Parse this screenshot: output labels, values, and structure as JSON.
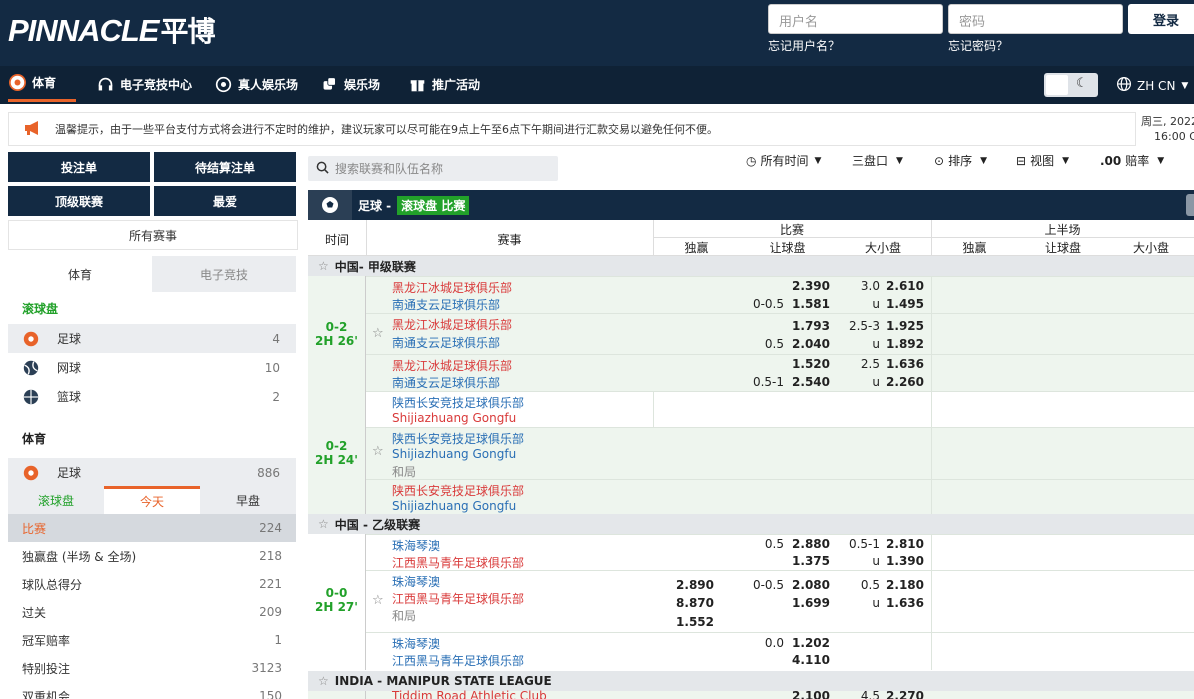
{
  "header": {
    "logo": "PINNACLE",
    "logo_cn": "平博",
    "username_placeholder": "用户名",
    "password_placeholder": "密码",
    "forgot_username": "忘记用户名？",
    "forgot_password": "忘记密码？",
    "login": "登录"
  },
  "nav": {
    "items": [
      "体育",
      "电子竞技中心",
      "真人娱乐场",
      "娱乐场",
      "推广活动"
    ],
    "lang": "ZH CN"
  },
  "notice": {
    "text": "温馨提示，由于一些平台支付方式将会进行不定时的维护，建议玩家可以尽可能在9点上午至6点下午期间进行汇款交易以避免任何不便。",
    "date_line1": "周三, 2022",
    "date_line2": "16:00 G"
  },
  "leftbtns": [
    "投注单",
    "待结算注单",
    "顶级联赛",
    "最爱"
  ],
  "all_events": "所有赛事",
  "sidebar": {
    "tab_sports": "体育",
    "tab_esports": "电子竞技",
    "live_label": "滚球盘",
    "live_sports": [
      {
        "name": "足球",
        "count": "4"
      },
      {
        "name": "网球",
        "count": "10"
      },
      {
        "name": "篮球",
        "count": "2"
      }
    ],
    "sports_label": "体育",
    "soccer": {
      "name": "足球",
      "count": "886"
    },
    "subtabs": [
      "滚球盘",
      "今天",
      "早盘"
    ],
    "markets": [
      {
        "name": "比赛",
        "count": "224"
      },
      {
        "name": "独赢盘 (半场 & 全场)",
        "count": "218"
      },
      {
        "name": "球队总得分",
        "count": "221"
      },
      {
        "name": "过关",
        "count": "209"
      },
      {
        "name": "冠军赔率",
        "count": "1"
      },
      {
        "name": "特别投注",
        "count": "3123"
      },
      {
        "name": "双重机会",
        "count": "150"
      }
    ]
  },
  "toolbar": {
    "search_placeholder": "搜索联赛和队伍名称",
    "all_time": "所有时间",
    "three_lines": "三盘口",
    "sort": "排序",
    "view": "视图",
    "odds_prefix": ".00",
    "odds": "赔率"
  },
  "grid": {
    "title": "足球 -",
    "badge": "滚球盘 比赛",
    "col_time": "时间",
    "col_event": "赛事",
    "group_match": "比赛",
    "group_half": "上半场",
    "sub_cols": [
      "独赢",
      "让球盘",
      "大小盘",
      "独赢",
      "让球盘",
      "大小盘"
    ],
    "leagues": [
      {
        "name": "中国- 甲级联赛",
        "events": [
          {
            "score": "0-2",
            "time": "2H 26'",
            "lines": [
              {
                "home": "黑龙江冰城足球俱乐部",
                "away": "南通支云足球俱乐部",
                "hcp_line": "0-0.5",
                "hcp_home": "2.390",
                "hcp_away": "1.581",
                "ou_line": "3.0",
                "ou_u": "u",
                "ou_over": "2.610",
                "ou_under": "1.495"
              },
              {
                "home": "黑龙江冰城足球俱乐部",
                "away": "南通支云足球俱乐部",
                "hcp_line": "0.5",
                "hcp_home": "1.793",
                "hcp_away": "2.040",
                "ou_line": "2.5-3",
                "ou_u": "u",
                "ou_over": "1.925",
                "ou_under": "1.892"
              },
              {
                "home": "黑龙江冰城足球俱乐部",
                "away": "南通支云足球俱乐部",
                "hcp_line": "0.5-1",
                "hcp_home": "1.520",
                "hcp_away": "2.540",
                "ou_line": "2.5",
                "ou_u": "u",
                "ou_over": "1.636",
                "ou_under": "2.260"
              }
            ]
          },
          {
            "score": "0-2",
            "time": "2H 24'",
            "lines": [
              {
                "home": "陕西长安竞技足球俱乐部",
                "away": "Shijiazhuang Gongfu"
              },
              {
                "home": "陕西长安竞技足球俱乐部",
                "away": "Shijiazhuang Gongfu",
                "draw": "和局"
              },
              {
                "home": "陕西长安竞技足球俱乐部",
                "away": "Shijiazhuang Gongfu"
              }
            ]
          }
        ]
      },
      {
        "name": "中国 - 乙级联赛",
        "events": [
          {
            "score": "0-0",
            "time": "2H 27'",
            "lines": [
              {
                "home": "珠海琴澳",
                "away": "江西黑马青年足球俱乐部",
                "hcp_line": "0.5",
                "hcp_home": "2.880",
                "hcp_away": "1.375",
                "ou_line": "0.5-1",
                "ou_u": "u",
                "ou_over": "2.810",
                "ou_under": "1.390"
              },
              {
                "home": "珠海琴澳",
                "away": "江西黑马青年足球俱乐部",
                "draw": "和局",
                "ml_home": "2.890",
                "ml_away": "8.870",
                "ml_draw": "1.552",
                "hcp_line": "0-0.5",
                "hcp_home": "2.080",
                "hcp_away": "1.699",
                "ou_line": "0.5",
                "ou_u": "u",
                "ou_over": "2.180",
                "ou_under": "1.636"
              },
              {
                "home": "珠海琴澳",
                "away": "江西黑马青年足球俱乐部",
                "hcp_line": "0.0",
                "hcp_home": "1.202",
                "hcp_away": "4.110"
              }
            ]
          }
        ]
      },
      {
        "name": "INDIA - MANIPUR STATE LEAGUE",
        "events": [
          {
            "lines": [
              {
                "home": "Tiddim Road Athletic Club",
                "hcp_home": "2.100",
                "ou_line": "4.5",
                "ou_over": "2.270"
              }
            ]
          }
        ]
      }
    ]
  }
}
